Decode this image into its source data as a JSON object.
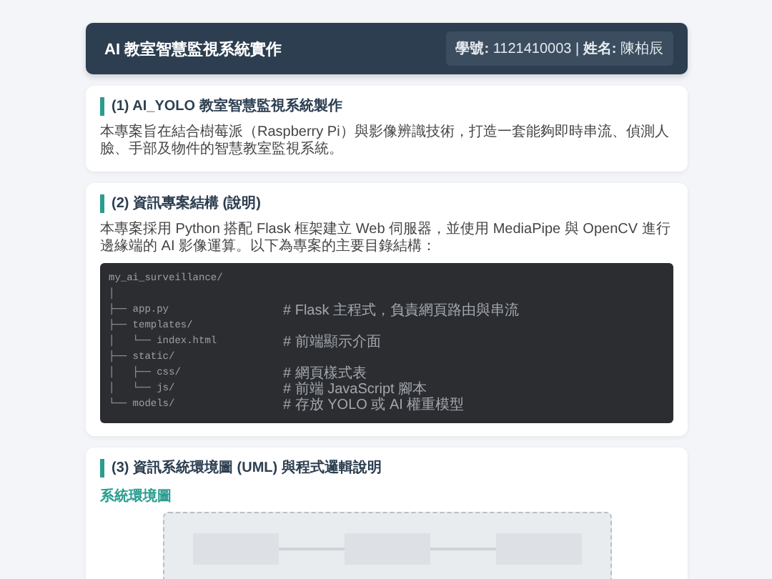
{
  "header": {
    "title": "AI 教室智慧監視系統實作",
    "badge": "**學號:** 1121410003 | **姓名:** 陳柏辰"
  },
  "sections": [
    {
      "title": "(1) AI_YOLO 教室智慧監視系統製作",
      "text": "本專案旨在結合樹莓派（Raspberry Pi）與影像辨識技術，打造一套能夠即時串流、偵測人臉、手部及物件的智慧教室監視系統。"
    },
    {
      "title": "(2) 資訊專案結構 (說明)",
      "text": "本專案採用 Python 搭配 Flask 框架建立 Web 伺服器，並使用 MediaPipe 與 OpenCV 進行邊緣端的 AI 影像運算。以下為專案的主要目錄結構：",
      "code": [
        {
          "tree": "my_ai_surveillance/"
        },
        {
          "tree": "│"
        },
        {
          "tree": "├── app.py",
          "comment": "# Flask 主程式，負責網頁路由與串流"
        },
        {
          "tree": "├── templates/"
        },
        {
          "tree": "│   └── index.html",
          "comment": "# 前端顯示介面"
        },
        {
          "tree": "├── static/"
        },
        {
          "tree": "│   ├── css/",
          "comment": "# 網頁樣式表"
        },
        {
          "tree": "│   └── js/",
          "comment": "# 前端 JavaScript 腳本"
        },
        {
          "tree": "└── models/",
          "comment": "# 存放 YOLO 或 AI 權重模型"
        }
      ]
    },
    {
      "title": "(3) 資訊系統環境圖 (UML) 與程式邏輯說明",
      "subtitle": "系統環境圖",
      "diagram": {
        "kind": "picture"
      }
    }
  ]
}
